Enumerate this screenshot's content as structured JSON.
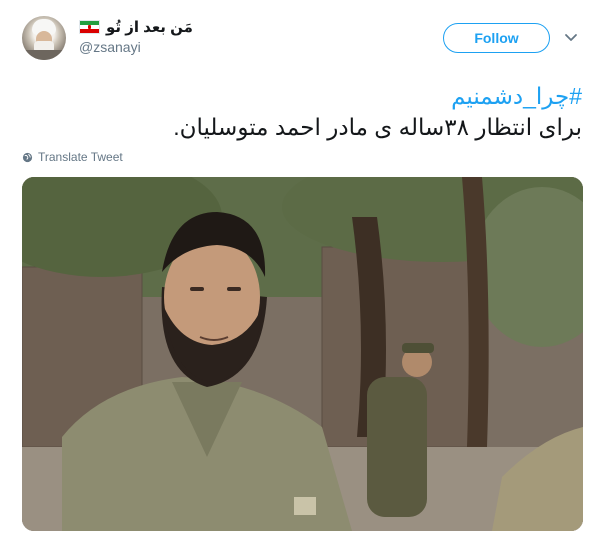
{
  "tweet": {
    "display_name": "مَن بعد از تُو",
    "handle": "@zsanayi",
    "follow_label": "Follow",
    "hashtag": "#چرا_دشمنیم",
    "text": "برای انتظار ۳۸ساله ی مادر احمد متوسلیان.",
    "translate_label": "Translate Tweet"
  },
  "colors": {
    "accent": "#1da1f2",
    "text": "#14171a",
    "muted": "#657786"
  },
  "icons": {
    "flag": "iran-flag-icon",
    "more": "chevron-down-icon",
    "translate": "globe-icon"
  }
}
